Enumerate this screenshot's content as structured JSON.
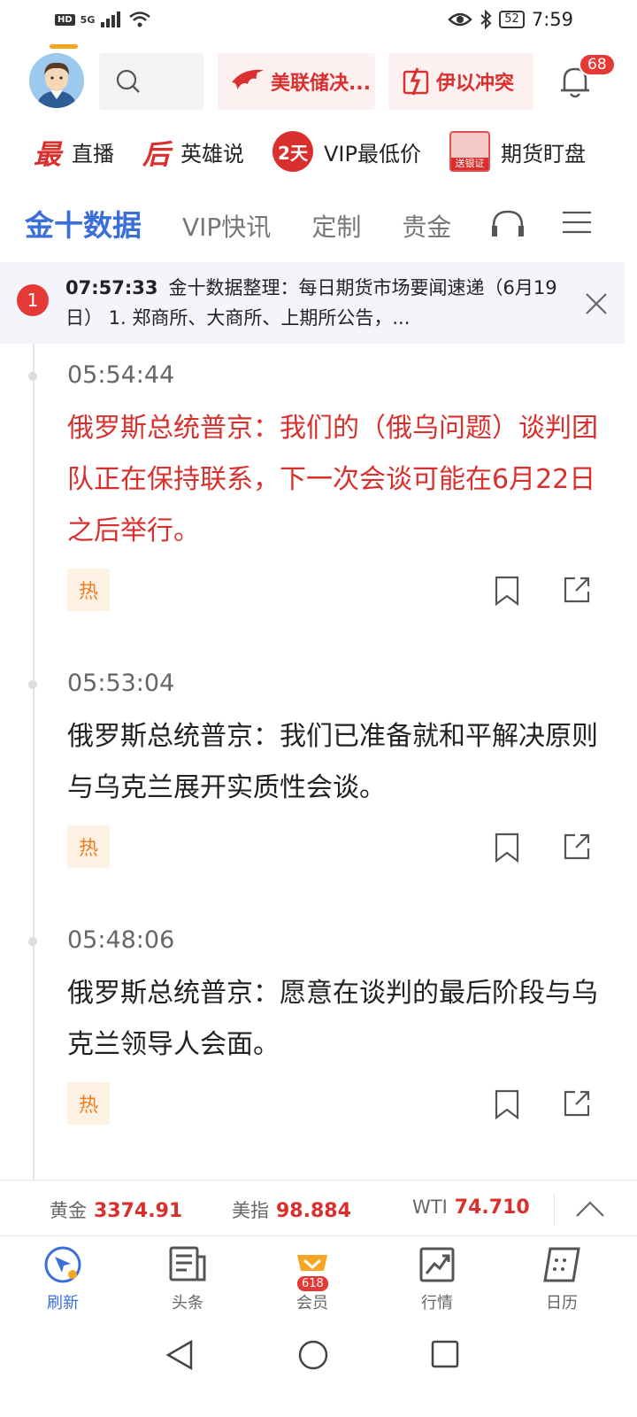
{
  "status_bar": {
    "left_badge": "HD",
    "network": "5G",
    "battery": "52",
    "time": "7:59"
  },
  "header": {
    "promo1_label": "美联储决...",
    "promo2_label": "伊以冲突",
    "notification_count": "68"
  },
  "shortcuts": [
    {
      "glyph": "最",
      "label": "直播"
    },
    {
      "glyph": "后",
      "label": "英雄说"
    },
    {
      "glyph": "2天",
      "label": "VIP最低价"
    },
    {
      "badge": "送银证",
      "label": "期货盯盘"
    }
  ],
  "tabs": [
    "金十数据",
    "VIP快讯",
    "定制",
    "贵金"
  ],
  "banner": {
    "badge": "1",
    "time": "07:57:33",
    "text": "金十数据整理：每日期货市场要闻速递（6月19日） 1. 郑商所、大商所、上期所公告，..."
  },
  "news": [
    {
      "time": "05:54:44",
      "text": "俄罗斯总统普京：我们的（俄乌问题）谈判团队正在保持联系，下一次会谈可能在6月22日之后举行。",
      "tag": "热",
      "highlight": true
    },
    {
      "time": "05:53:04",
      "text": "俄罗斯总统普京：我们已准备就和平解决原则与乌克兰展开实质性会谈。",
      "tag": "热",
      "highlight": false
    },
    {
      "time": "05:48:06",
      "text": "俄罗斯总统普京：愿意在谈判的最后阶段与乌克兰领导人会面。",
      "tag": "热",
      "highlight": false
    }
  ],
  "ticker": [
    {
      "name": "黄金",
      "value": "3374.91"
    },
    {
      "name": "美指",
      "value": "98.884"
    },
    {
      "name": "WTI",
      "value": "74.710"
    }
  ],
  "bottom_nav": [
    {
      "label": "刷新",
      "active": true
    },
    {
      "label": "头条",
      "active": false
    },
    {
      "label": "会员",
      "badge": "618",
      "active": false
    },
    {
      "label": "行情",
      "active": false
    },
    {
      "label": "日历",
      "active": false
    }
  ],
  "colors": {
    "accent_blue": "#3a6fd8",
    "alert_red": "#d9302e",
    "hot_orange": "#ef7d22",
    "underline_orange": "#f7a623"
  }
}
